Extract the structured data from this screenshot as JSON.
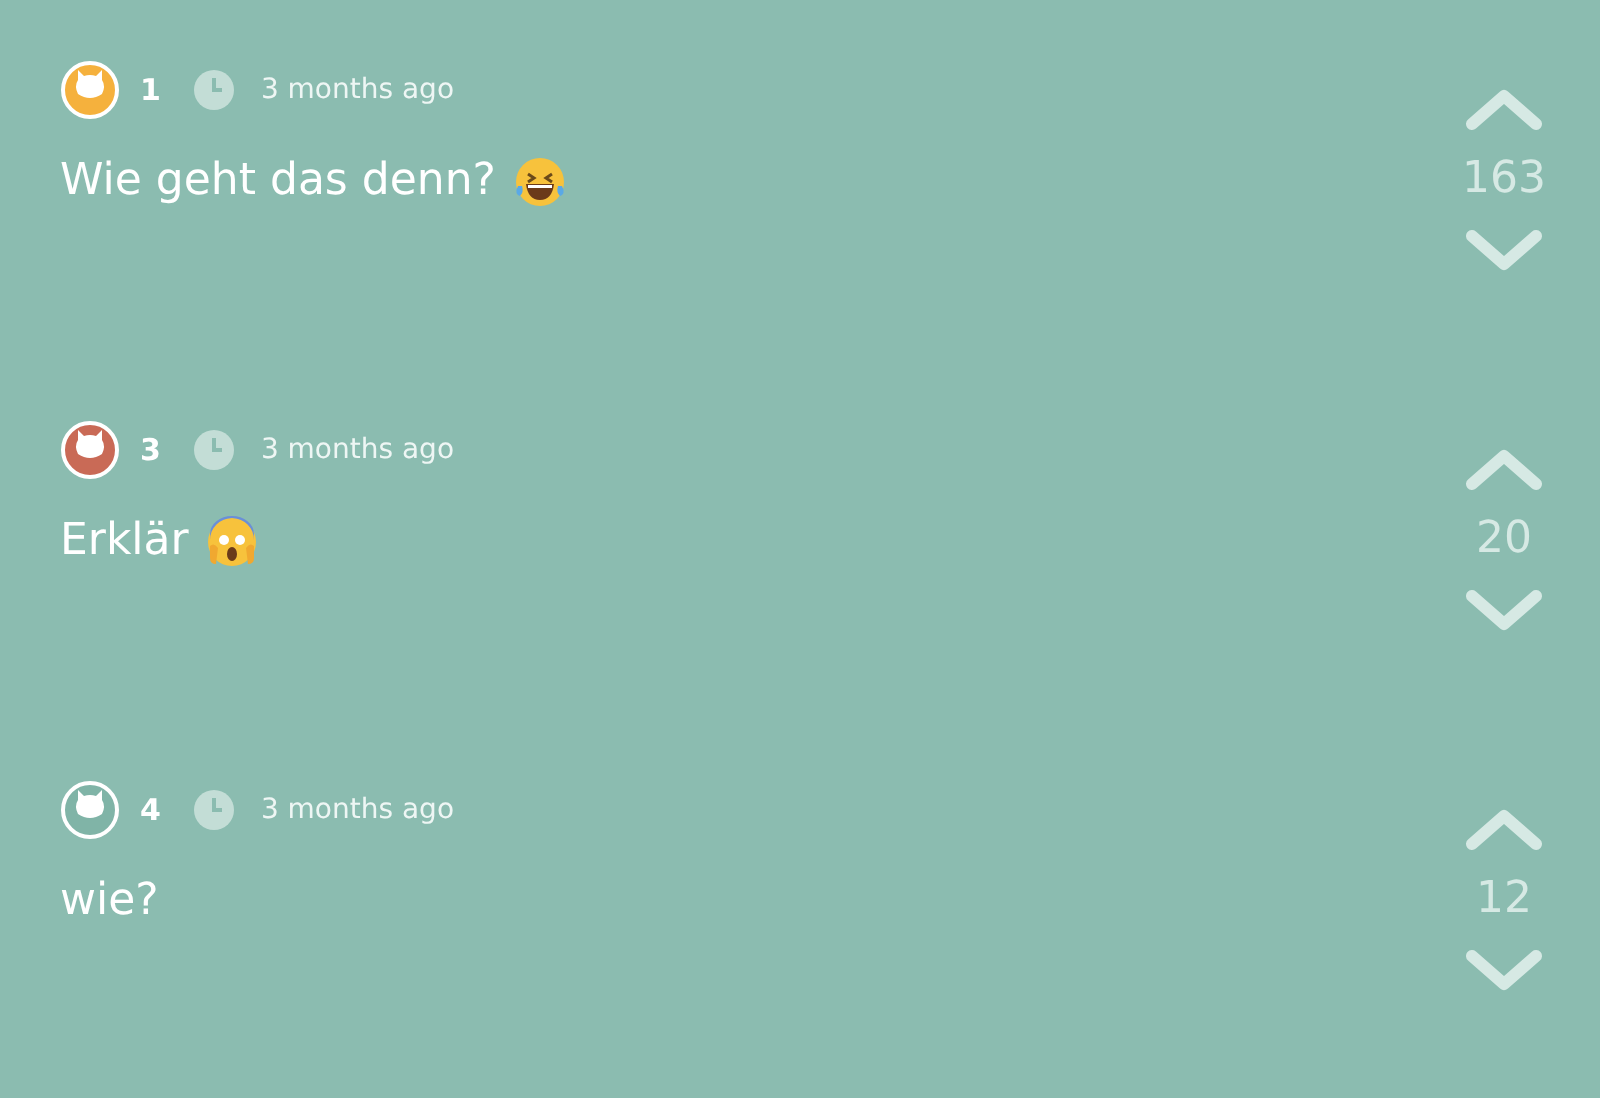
{
  "comments": [
    {
      "color": "#f5b13d",
      "user": "1",
      "time": "3 months ago",
      "text": "Wie geht das denn?",
      "emoji": {
        "kind": "laughing"
      },
      "votes": "163"
    },
    {
      "color": "#c96a56",
      "user": "3",
      "time": "3 months ago",
      "text": "Erklär",
      "emoji": {
        "kind": "screaming"
      },
      "votes": "20"
    },
    {
      "color": "#80b4a7",
      "user": "4",
      "time": "3 months ago",
      "text": "wie?",
      "votes": "12"
    }
  ]
}
